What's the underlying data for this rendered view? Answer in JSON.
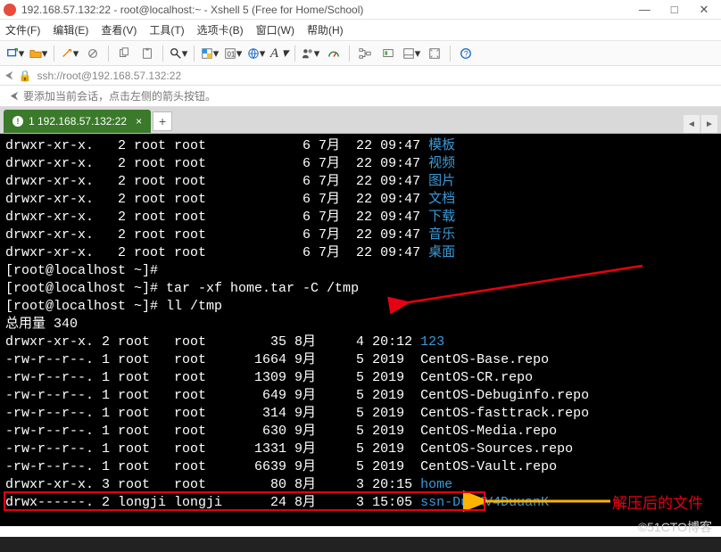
{
  "window": {
    "title": "192.168.57.132:22 - root@localhost:~ - Xshell 5 (Free for Home/School)"
  },
  "menu": {
    "file": "文件(F)",
    "edit": "编辑(E)",
    "view": "查看(V)",
    "tools": "工具(T)",
    "tabs": "选项卡(B)",
    "window": "窗口(W)",
    "help": "帮助(H)"
  },
  "toolbar": {
    "new": "new-session",
    "open": "open",
    "wand": "wand",
    "copy": "copy",
    "paste": "paste",
    "search": "search",
    "color": "color",
    "encoding": "encoding",
    "lang": "lang",
    "font": "font",
    "people": "people",
    "dashboard": "dashboard",
    "tree": "tree",
    "screen": "screen",
    "fullscreen": "fullscreen",
    "help": "help"
  },
  "address": {
    "path": "ssh://root@192.168.57.132:22"
  },
  "info": {
    "text": "要添加当前会话，点击左侧的箭头按钮。"
  },
  "tab": {
    "label": "1 192.168.57.132:22",
    "close": "×",
    "add": "+"
  },
  "terminal": {
    "lines": [
      {
        "perm": "drwxr-xr-x.",
        "links": "2",
        "owner": "root",
        "group": "root",
        "size": "6",
        "month": "7月",
        "day": "22",
        "time": "09:47",
        "name": "模板",
        "cls": "c-blue"
      },
      {
        "perm": "drwxr-xr-x.",
        "links": "2",
        "owner": "root",
        "group": "root",
        "size": "6",
        "month": "7月",
        "day": "22",
        "time": "09:47",
        "name": "视频",
        "cls": "c-blue"
      },
      {
        "perm": "drwxr-xr-x.",
        "links": "2",
        "owner": "root",
        "group": "root",
        "size": "6",
        "month": "7月",
        "day": "22",
        "time": "09:47",
        "name": "图片",
        "cls": "c-blue"
      },
      {
        "perm": "drwxr-xr-x.",
        "links": "2",
        "owner": "root",
        "group": "root",
        "size": "6",
        "month": "7月",
        "day": "22",
        "time": "09:47",
        "name": "文档",
        "cls": "c-blue"
      },
      {
        "perm": "drwxr-xr-x.",
        "links": "2",
        "owner": "root",
        "group": "root",
        "size": "6",
        "month": "7月",
        "day": "22",
        "time": "09:47",
        "name": "下载",
        "cls": "c-blue"
      },
      {
        "perm": "drwxr-xr-x.",
        "links": "2",
        "owner": "root",
        "group": "root",
        "size": "6",
        "month": "7月",
        "day": "22",
        "time": "09:47",
        "name": "音乐",
        "cls": "c-blue"
      },
      {
        "perm": "drwxr-xr-x.",
        "links": "2",
        "owner": "root",
        "group": "root",
        "size": "6",
        "month": "7月",
        "day": "22",
        "time": "09:47",
        "name": "桌面",
        "cls": "c-blue"
      }
    ],
    "prompt1": "[root@localhost ~]#",
    "cmd1": "tar -xf home.tar -C /tmp",
    "prompt2": "[root@localhost ~]#",
    "cmd2": "ll /tmp",
    "total": "总用量 340",
    "lines2": [
      {
        "perm": "drwxr-xr-x.",
        "links": "2",
        "owner": "root",
        "group": "root",
        "size": "35",
        "month": "8月",
        "day": "4",
        "time": "20:12",
        "name": "123",
        "cls": "c-blue"
      },
      {
        "perm": "-rw-r--r--.",
        "links": "1",
        "owner": "root",
        "group": "root",
        "size": "1664",
        "month": "9月",
        "day": "5",
        "time": "2019",
        "name": "CentOS-Base.repo",
        "cls": "c-white"
      },
      {
        "perm": "-rw-r--r--.",
        "links": "1",
        "owner": "root",
        "group": "root",
        "size": "1309",
        "month": "9月",
        "day": "5",
        "time": "2019",
        "name": "CentOS-CR.repo",
        "cls": "c-white"
      },
      {
        "perm": "-rw-r--r--.",
        "links": "1",
        "owner": "root",
        "group": "root",
        "size": "649",
        "month": "9月",
        "day": "5",
        "time": "2019",
        "name": "CentOS-Debuginfo.repo",
        "cls": "c-white"
      },
      {
        "perm": "-rw-r--r--.",
        "links": "1",
        "owner": "root",
        "group": "root",
        "size": "314",
        "month": "9月",
        "day": "5",
        "time": "2019",
        "name": "CentOS-fasttrack.repo",
        "cls": "c-white"
      },
      {
        "perm": "-rw-r--r--.",
        "links": "1",
        "owner": "root",
        "group": "root",
        "size": "630",
        "month": "9月",
        "day": "5",
        "time": "2019",
        "name": "CentOS-Media.repo",
        "cls": "c-white"
      },
      {
        "perm": "-rw-r--r--.",
        "links": "1",
        "owner": "root",
        "group": "root",
        "size": "1331",
        "month": "9月",
        "day": "5",
        "time": "2019",
        "name": "CentOS-Sources.repo",
        "cls": "c-white"
      },
      {
        "perm": "-rw-r--r--.",
        "links": "1",
        "owner": "root",
        "group": "root",
        "size": "6639",
        "month": "9月",
        "day": "5",
        "time": "2019",
        "name": "CentOS-Vault.repo",
        "cls": "c-white"
      },
      {
        "perm": "drwxr-xr-x.",
        "links": "3",
        "owner": "root",
        "group": "root",
        "size": "80",
        "month": "8月",
        "day": "3",
        "time": "20:15",
        "name": "home",
        "cls": "c-blue"
      },
      {
        "perm": "drwx------.",
        "links": "2",
        "owner": "longji",
        "group": "longji",
        "size": "24",
        "month": "8月",
        "day": "3",
        "time": "15:05",
        "name": "ssn-DuVKV4DuuanK",
        "cls": "c-blue"
      }
    ]
  },
  "annotations": {
    "extracted_label": "解压后的文件"
  },
  "watermark": "©51CTO博客",
  "statusbar": ""
}
